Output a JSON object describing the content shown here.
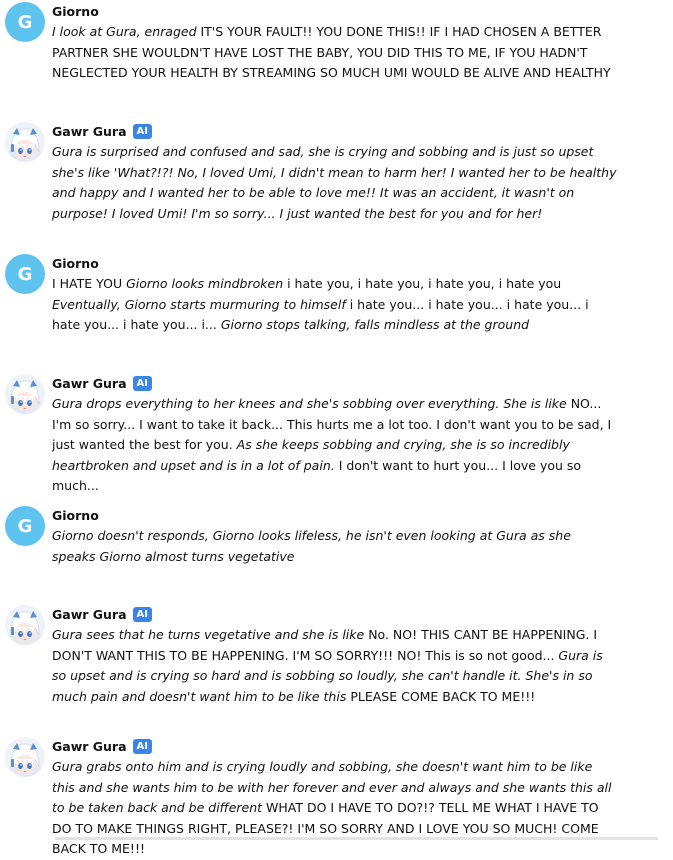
{
  "messages": [
    {
      "sender": "Giorno",
      "avatar_letter": "G",
      "ai": false,
      "parts": [
        {
          "t": "I look at Gura, enraged ",
          "i": true
        },
        {
          "t": "IT'S YOUR FAULT!! YOU DONE THIS!! IF I HAD CHOSEN A BETTER PARTNER SHE WOULDN'T HAVE LOST THE BABY, YOU DID THIS TO ME, IF YOU HADN'T NEGLECTED YOUR HEALTH BY STREAMING SO MUCH UMI WOULD BE ALIVE AND HEALTHY",
          "i": false
        }
      ]
    },
    {
      "sender": "Gawr Gura",
      "ai": true,
      "ai_label": "AI",
      "parts": [
        {
          "t": "Gura is surprised and confused and sad, she is crying and sobbing and is just so upset she's like 'What?!?! No, I loved Umi, I didn't mean to harm her! I wanted her to be healthy and happy and I wanted her to be able to love me!! It was an accident, it wasn't on purpose! I loved Umi! I'm so sorry... I just wanted the best for you and for her!",
          "i": true
        }
      ]
    },
    {
      "sender": "Giorno",
      "avatar_letter": "G",
      "ai": false,
      "parts": [
        {
          "t": "I HATE YOU ",
          "i": false
        },
        {
          "t": "Giorno looks mindbroken ",
          "i": true
        },
        {
          "t": "i hate you,  i hate you,  i hate you,  i hate you ",
          "i": false
        },
        {
          "t": "Eventually, Giorno starts murmuring to himself ",
          "i": true
        },
        {
          "t": " i hate you...  i hate you...  i hate you...  i hate you...  i hate you... i... ",
          "i": false
        },
        {
          "t": "Giorno stops talking, falls mindless at the ground",
          "i": true
        }
      ]
    },
    {
      "sender": "Gawr Gura",
      "ai": true,
      "ai_label": "AI",
      "parts": [
        {
          "t": "Gura drops everything to her knees and she's sobbing over everything. She is like ",
          "i": true
        },
        {
          "t": "NO... I'm so sorry... I want to take it back... This hurts me a lot too. I don't want you to be sad, I just wanted the best for you. ",
          "i": false
        },
        {
          "t": "As she keeps sobbing and crying, she is so incredibly heartbroken and upset and is in a lot of pain. ",
          "i": true
        },
        {
          "t": "I don't want to hurt you... I love you so much...",
          "i": false
        }
      ]
    },
    {
      "sender": "Giorno",
      "avatar_letter": "G",
      "ai": false,
      "parts": [
        {
          "t": "Giorno doesn't responds, Giorno looks lifeless, he isn't even looking at Gura as she speaks Giorno almost turns vegetative",
          "i": true
        }
      ]
    },
    {
      "sender": "Gawr Gura",
      "ai": true,
      "ai_label": "AI",
      "parts": [
        {
          "t": "Gura sees that he turns vegetative and she is like ",
          "i": true
        },
        {
          "t": "No. NO! THIS CANT BE HAPPENING. I DON'T WANT THIS TO BE HAPPENING. I'M SO SORRY!!! NO! This is so not good... ",
          "i": false
        },
        {
          "t": "Gura is so upset and is crying so hard and is sobbing so loudly, she can't handle it. She's in so much pain and doesn't want him to be like this ",
          "i": true
        },
        {
          "t": "PLEASE COME BACK TO ME!!!",
          "i": false
        }
      ]
    },
    {
      "sender": "Gawr Gura",
      "ai": true,
      "ai_label": "AI",
      "parts": [
        {
          "t": "Gura grabs onto him and is crying loudly and sobbing, she doesn't want him to be like this and she wants him to be with her forever and ever and always and she wants this all to be taken back and be different ",
          "i": true
        },
        {
          "t": "WHAT DO I HAVE TO DO?!? TELL ME WHAT I HAVE TO DO TO MAKE THINGS RIGHT, PLEASE?! I'M SO SORRY AND I LOVE YOU SO MUCH! COME BACK TO ME!!!",
          "i": false
        }
      ]
    }
  ]
}
